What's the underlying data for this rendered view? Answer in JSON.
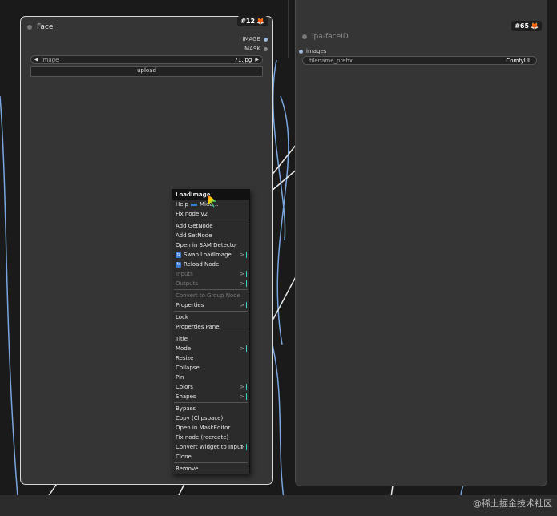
{
  "face_node": {
    "title": "Face",
    "badge": "#12",
    "outputs": [
      "IMAGE",
      "MASK"
    ],
    "image_widget": {
      "name": "image",
      "value": "71.jpg"
    },
    "upload_label": "upload"
  },
  "save_node": {
    "title": "ipa-faceID",
    "badge": "#65",
    "input_label": "images",
    "filename_widget": {
      "name": "filename_prefix",
      "value": "ComfyUI"
    }
  },
  "context_menu": {
    "title": "LoadImage",
    "items": [
      {
        "label": "Help",
        "extra": "Mida..."
      },
      {
        "label": "Fix node v2"
      },
      {
        "label": "Add GetNode"
      },
      {
        "label": "Add SetNode"
      },
      {
        "label": "Open in SAM Detector"
      },
      {
        "label": "Swap LoadImage"
      },
      {
        "label": "Reload Node"
      },
      {
        "label": "Inputs"
      },
      {
        "label": "Outputs"
      },
      {
        "label": "Convert to Group Node"
      },
      {
        "label": "Properties"
      },
      {
        "label": "Lock"
      },
      {
        "label": "Properties Panel"
      },
      {
        "label": "Title"
      },
      {
        "label": "Mode"
      },
      {
        "label": "Resize"
      },
      {
        "label": "Collapse"
      },
      {
        "label": "Pin"
      },
      {
        "label": "Colors"
      },
      {
        "label": "Shapes"
      },
      {
        "label": "Bypass"
      },
      {
        "label": "Copy (Clipspace)"
      },
      {
        "label": "Open in MaskEditor"
      },
      {
        "label": "Fix node (recreate)"
      },
      {
        "label": "Convert Widget to Input"
      },
      {
        "label": "Clone"
      },
      {
        "label": "Remove"
      }
    ],
    "submenu_marker": ">"
  },
  "watermark": "@稀土掘金技术社区",
  "colors": {
    "canvas": "#1a1a1a",
    "node_body": "#353535",
    "link": "#7aa6e0",
    "accent_submenu": "#35d0c0"
  }
}
